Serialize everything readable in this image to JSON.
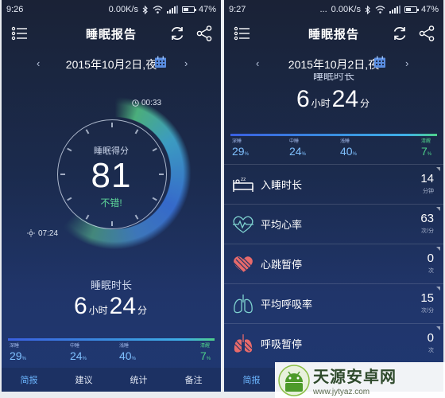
{
  "left": {
    "status": {
      "time": "9:26",
      "speed": "0.00K/s",
      "battery": "47%",
      "battery_level": 0.47
    },
    "header": {
      "title": "睡眠报告"
    },
    "date": {
      "text": "2015年10月2日,夜",
      "prev": "‹",
      "next": "›"
    },
    "dial": {
      "label": "睡眠得分",
      "score": "81",
      "desc": "不错!",
      "end_time": "00:33",
      "start_time": "07:24"
    },
    "duration": {
      "label": "睡眠时长",
      "hours": "6",
      "hours_unit": "小时",
      "minutes": "24",
      "minutes_unit": "分"
    },
    "stages": [
      {
        "name": "深睡",
        "value": "29",
        "unit": "%"
      },
      {
        "name": "中睡",
        "value": "24",
        "unit": "%"
      },
      {
        "name": "浅睡",
        "value": "40",
        "unit": "%"
      },
      {
        "name": "清醒",
        "value": "7",
        "unit": "%"
      }
    ],
    "tabs": [
      {
        "label": "简报",
        "active": true
      },
      {
        "label": "建议",
        "active": false
      },
      {
        "label": "统计",
        "active": false
      },
      {
        "label": "备注",
        "active": false
      }
    ]
  },
  "right": {
    "status": {
      "time": "9:27",
      "dots": "...",
      "speed": "0.00K/s",
      "battery": "47%",
      "battery_level": 0.47
    },
    "header": {
      "title": "睡眠报告"
    },
    "date": {
      "text": "2015年10月2日,夜",
      "prev": "‹",
      "next": "›"
    },
    "duration": {
      "label": "睡眠时长",
      "hours": "6",
      "hours_unit": "小时",
      "minutes": "24",
      "minutes_unit": "分"
    },
    "stages": [
      {
        "name": "深睡",
        "value": "29",
        "unit": "%"
      },
      {
        "name": "中睡",
        "value": "24",
        "unit": "%"
      },
      {
        "name": "浅睡",
        "value": "40",
        "unit": "%"
      },
      {
        "name": "清醒",
        "value": "7",
        "unit": "%"
      }
    ],
    "metrics": [
      {
        "icon": "bed-icon",
        "name": "入睡时长",
        "value": "14",
        "unit": "分钟"
      },
      {
        "icon": "heartbeat-icon",
        "name": "平均心率",
        "value": "63",
        "unit": "次/分"
      },
      {
        "icon": "heart-pause-icon",
        "name": "心跳暂停",
        "value": "0",
        "unit": "次"
      },
      {
        "icon": "lungs-icon",
        "name": "平均呼吸率",
        "value": "15",
        "unit": "次/分"
      },
      {
        "icon": "lungs-pause-icon",
        "name": "呼吸暂停",
        "value": "0",
        "unit": "次"
      }
    ],
    "tabs": [
      {
        "label": "简报",
        "active": true
      }
    ]
  },
  "watermark": {
    "title": "天源安卓网",
    "url": "www.jytyaz.com"
  },
  "colors": {
    "accent": "#6cb6ff",
    "good": "#5ed79a",
    "bg_top": "#1a2236",
    "bg_bottom": "#1f3872"
  }
}
